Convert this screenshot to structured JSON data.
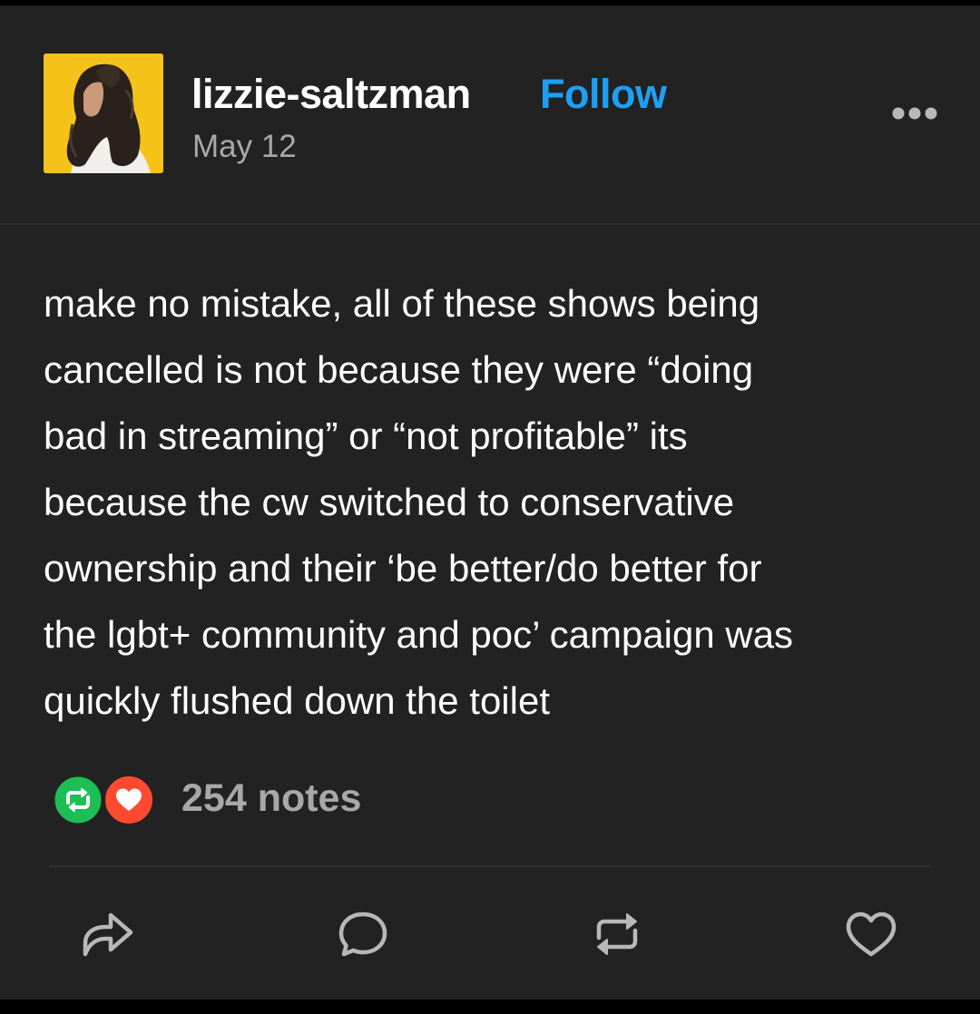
{
  "post": {
    "username": "lizzie-saltzman",
    "follow_label": "Follow",
    "date": "May 12",
    "body_lines": [
      "make no mistake, all of these shows being",
      "cancelled is not because they were “doing",
      "bad in streaming” or “not profitable” its",
      "because the cw switched to conservative",
      "ownership and their ‘be better/do better for",
      "the lgbt+ community and poc’ campaign was",
      "quickly flushed down the toilet"
    ],
    "notes": "254 notes"
  },
  "colors": {
    "background": "#222222",
    "follow": "#1ea0f2",
    "reblog_badge": "#1dbf55",
    "like_badge": "#ff4930",
    "muted_text": "#a8a8a8"
  },
  "icons": {
    "header": [
      "more-options-icon"
    ],
    "notes": [
      "reblog-badge-icon",
      "like-badge-icon"
    ],
    "actions": [
      "share-icon",
      "reply-icon",
      "reblog-icon",
      "like-icon"
    ]
  }
}
